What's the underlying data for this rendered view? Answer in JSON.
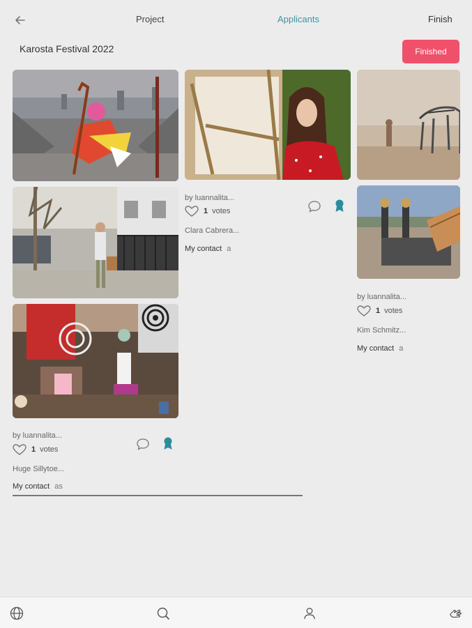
{
  "header": {
    "back_icon": "arrow-left-icon",
    "tabs": [
      {
        "label": "Project"
      },
      {
        "label": "Applicants",
        "active": true
      },
      {
        "label": "Finish"
      }
    ],
    "accent_color": "#3d95a0"
  },
  "project": {
    "title": "Karosta Festival 2022",
    "status_button": "Finished",
    "status_color": "#f0506a"
  },
  "cards": [
    {
      "author": "by luannalita...",
      "votes_count": "1",
      "votes_label": "votes",
      "name": "Clara Cabrera...",
      "contact_label": "My contact",
      "contact_suffix": "a"
    },
    {
      "author": "by luannalita...",
      "votes_count": "1",
      "votes_label": "votes",
      "name": "Kim Schmitz...",
      "contact_label": "My contact",
      "contact_suffix": "a"
    },
    {
      "author": "by luannalita...",
      "votes_count": "1",
      "votes_label": "votes",
      "name": "Huge Sillytoe...",
      "contact_label": "My contact",
      "contact_suffix": "as"
    }
  ],
  "bottom_nav": [
    "globe-icon",
    "search-icon",
    "profile-icon",
    "hand-icon"
  ]
}
